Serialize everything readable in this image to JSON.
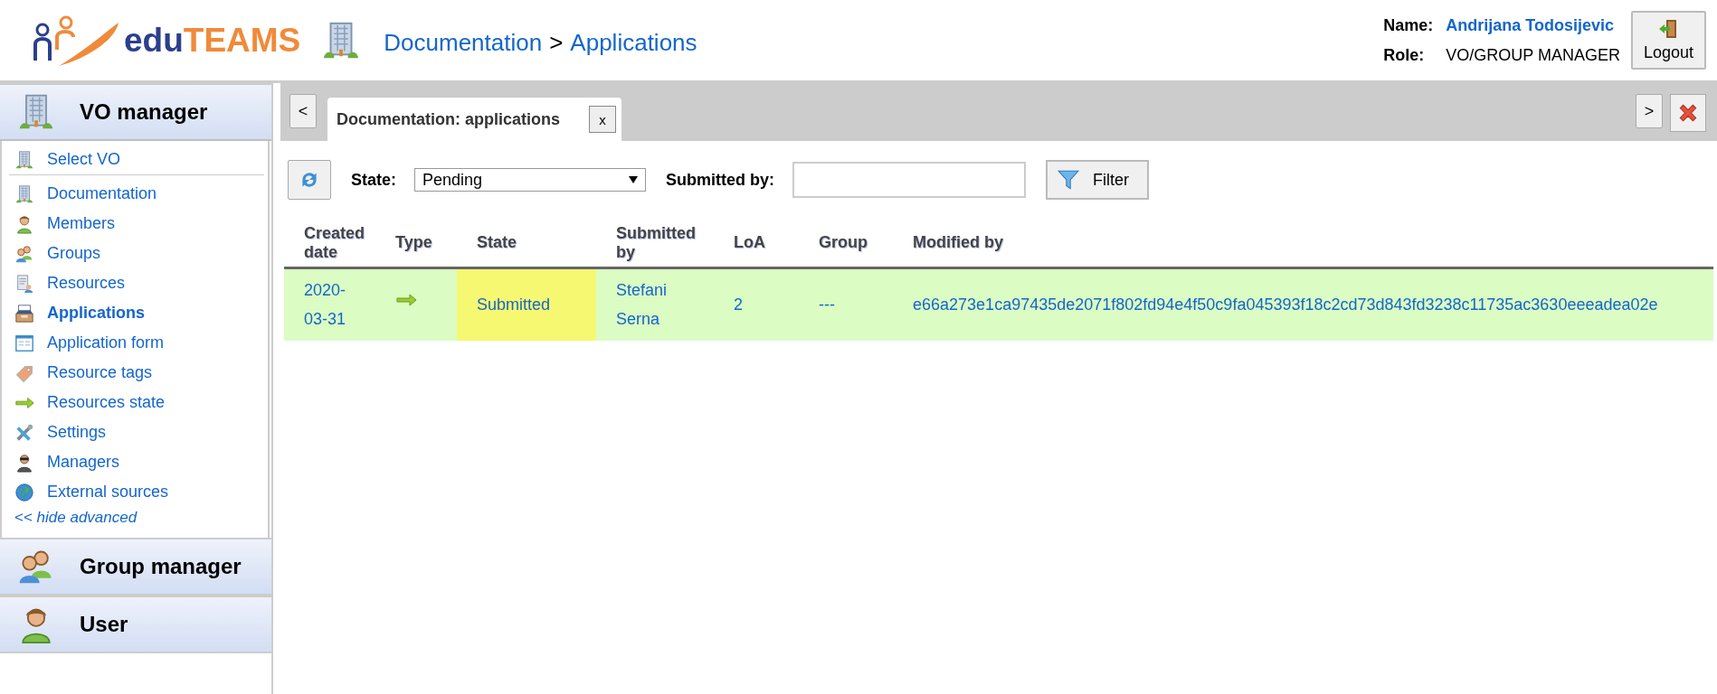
{
  "header": {
    "logo": {
      "first": "edu",
      "second": "TEAMS"
    },
    "breadcrumb": {
      "items": [
        "Documentation",
        "Applications"
      ],
      "separator": ">"
    },
    "user": {
      "name_label": "Name:",
      "name": "Andrijana Todosijevic",
      "role_label": "Role:",
      "role": "VO/GROUP MANAGER"
    },
    "logout": "Logout"
  },
  "sidebar": {
    "sections": [
      {
        "title": "VO manager",
        "kind": "building",
        "expanded": true,
        "items": [
          {
            "label": "Select VO",
            "kind": "building",
            "selected": false,
            "divider": true
          },
          {
            "label": "Documentation",
            "kind": "building",
            "selected": false
          },
          {
            "label": "Members",
            "kind": "person",
            "selected": false
          },
          {
            "label": "Groups",
            "kind": "people",
            "selected": false
          },
          {
            "label": "Resources",
            "kind": "document",
            "selected": false
          },
          {
            "label": "Applications",
            "kind": "tray",
            "selected": true
          },
          {
            "label": "Application form",
            "kind": "form",
            "selected": false
          },
          {
            "label": "Resource tags",
            "kind": "tag",
            "selected": false
          },
          {
            "label": "Resources state",
            "kind": "arrow",
            "selected": false
          },
          {
            "label": "Settings",
            "kind": "tools",
            "selected": false
          },
          {
            "label": "Managers",
            "kind": "manager",
            "selected": false
          },
          {
            "label": "External sources",
            "kind": "globe",
            "selected": false
          }
        ],
        "toggle": {
          "prefix": "<<",
          "label": "hide advanced"
        }
      },
      {
        "title": "Group manager",
        "kind": "people",
        "expanded": false
      },
      {
        "title": "User",
        "kind": "person",
        "expanded": false
      }
    ]
  },
  "tabs": {
    "prev": "<",
    "next": ">",
    "items": [
      {
        "label": "Documentation: applications",
        "close": "x",
        "selected": true
      }
    ]
  },
  "toolbar": {
    "state_label": "State:",
    "state_value": "Pending",
    "submitted_label": "Submitted by:",
    "filter": "Filter"
  },
  "table": {
    "columns": [
      "Created date",
      "Type",
      "State",
      "Submitted by",
      "LoA",
      "Group",
      "Modified by"
    ],
    "rows": [
      {
        "cells": [
          {
            "text": "2020-03-31"
          },
          {
            "kind": "arrow"
          },
          {
            "text": "Submitted",
            "highlighted": true
          },
          {
            "text": "Stefani Serna"
          },
          {
            "text": "2"
          },
          {
            "text": "---"
          },
          {
            "text": "e66a273e1ca97435de2071f802fd94e4f50c9fa045393f18c2cd73d843fd3238c11735ac3630eeeadea02e"
          }
        ]
      }
    ]
  }
}
